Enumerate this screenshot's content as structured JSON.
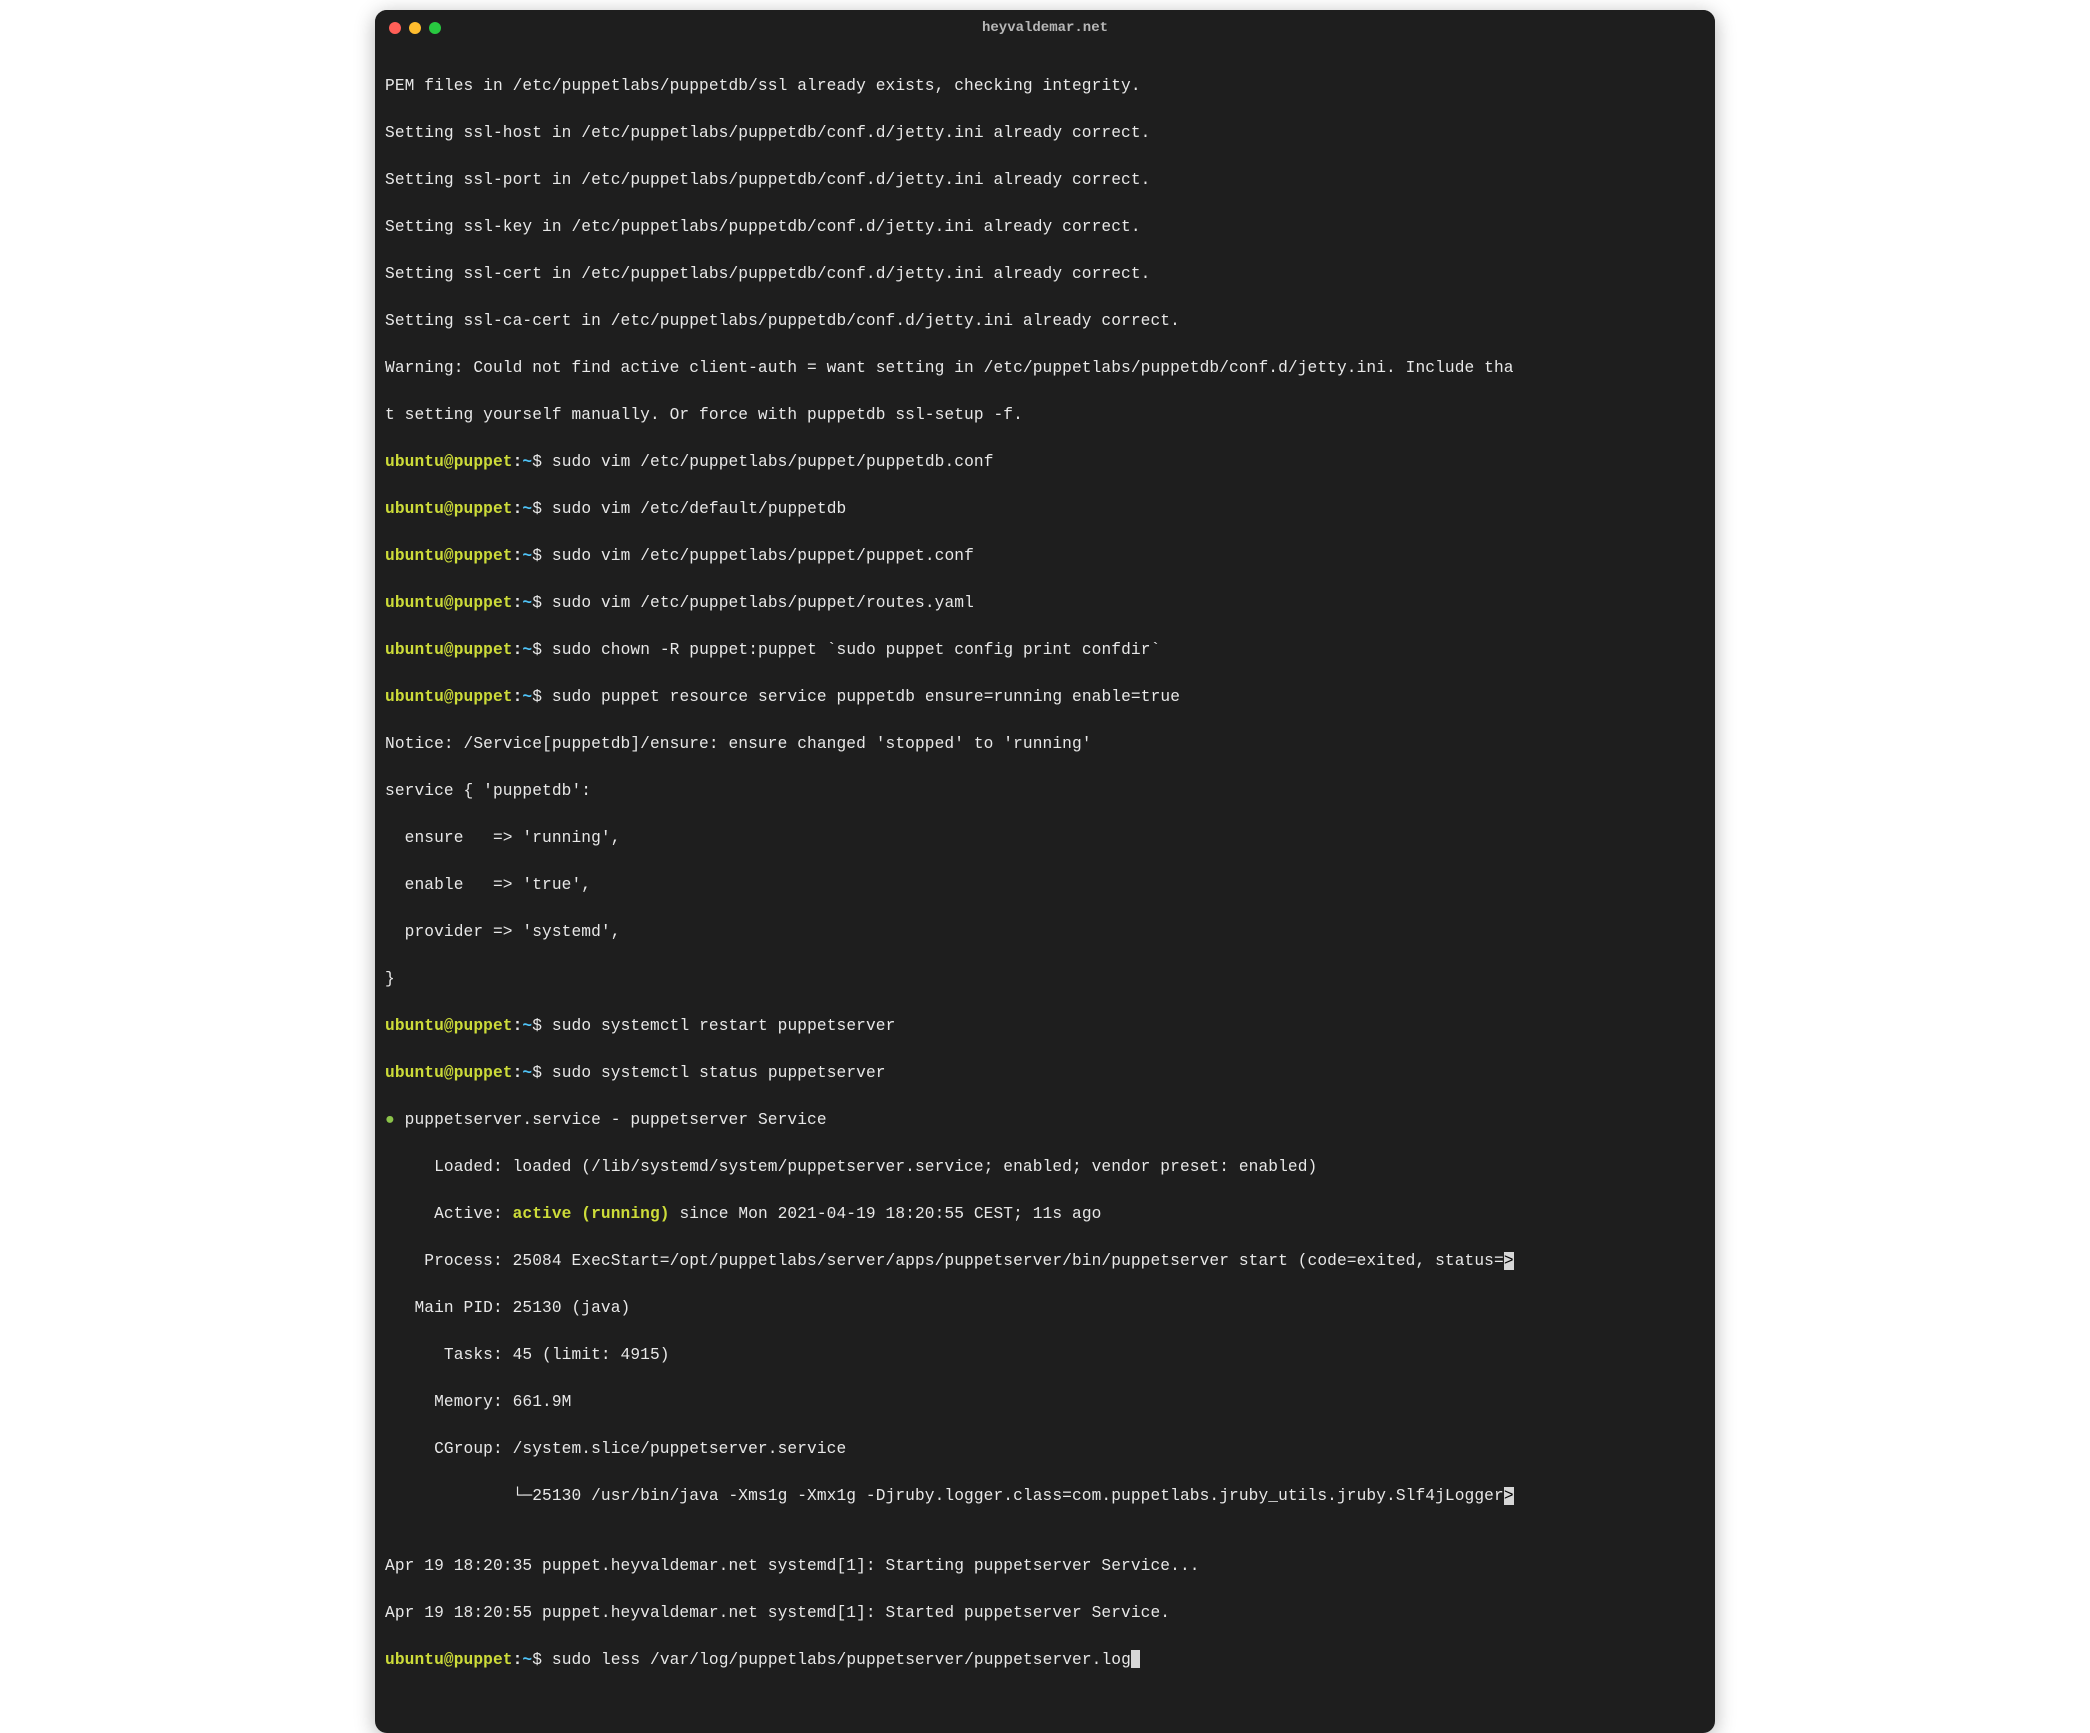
{
  "window": {
    "title": "heyvaldemar.net"
  },
  "prompt": {
    "user": "ubuntu@puppet",
    "sep": ":",
    "path": "~",
    "symbol": "$"
  },
  "lines": {
    "out0": "PEM files in /etc/puppetlabs/puppetdb/ssl already exists, checking integrity.",
    "out1": "Setting ssl-host in /etc/puppetlabs/puppetdb/conf.d/jetty.ini already correct.",
    "out2": "Setting ssl-port in /etc/puppetlabs/puppetdb/conf.d/jetty.ini already correct.",
    "out3": "Setting ssl-key in /etc/puppetlabs/puppetdb/conf.d/jetty.ini already correct.",
    "out4": "Setting ssl-cert in /etc/puppetlabs/puppetdb/conf.d/jetty.ini already correct.",
    "out5": "Setting ssl-ca-cert in /etc/puppetlabs/puppetdb/conf.d/jetty.ini already correct.",
    "out6": "Warning: Could not find active client-auth = want setting in /etc/puppetlabs/puppetdb/conf.d/jetty.ini. Include tha",
    "out7": "t setting yourself manually. Or force with puppetdb ssl-setup -f.",
    "cmd1": "sudo vim /etc/puppetlabs/puppet/puppetdb.conf",
    "cmd2": "sudo vim /etc/default/puppetdb",
    "cmd3": "sudo vim /etc/puppetlabs/puppet/puppet.conf",
    "cmd4": "sudo vim /etc/puppetlabs/puppet/routes.yaml",
    "cmd5": "sudo chown -R puppet:puppet `sudo puppet config print confdir`",
    "cmd6": "sudo puppet resource service puppetdb ensure=running enable=true",
    "out8": "Notice: /Service[puppetdb]/ensure: ensure changed 'stopped' to 'running'",
    "out9": "service { 'puppetdb':",
    "out10": "  ensure   => 'running',",
    "out11": "  enable   => 'true',",
    "out12": "  provider => 'systemd',",
    "out13": "}",
    "cmd7": "sudo systemctl restart puppetserver",
    "cmd8": "sudo systemctl status puppetserver",
    "svc_bullet": "●",
    "svc_name": " puppetserver.service - puppetserver Service",
    "svc_loaded": "     Loaded: loaded (/lib/systemd/system/puppetserver.service; enabled; vendor preset: enabled)",
    "svc_active_pre": "     Active: ",
    "svc_active_val": "active (running)",
    "svc_active_post": " since Mon 2021-04-19 18:20:55 CEST; 11s ago",
    "svc_process_pre": "    Process: 25084 ExecStart=/opt/puppetlabs/server/apps/puppetserver/bin/puppetserver start (code=exited, status=",
    "svc_process_tail": ">",
    "svc_mainpid": "   Main PID: 25130 (java)",
    "svc_tasks": "      Tasks: 45 (limit: 4915)",
    "svc_memory": "     Memory: 661.9M",
    "svc_cgroup": "     CGroup: /system.slice/puppetserver.service",
    "svc_cgroup2_pre": "             └─25130 /usr/bin/java -Xms1g -Xmx1g -Djruby.logger.class=com.puppetlabs.jruby_utils.jruby.Slf4jLogger",
    "svc_cgroup2_tail": ">",
    "blank": "",
    "log1": "Apr 19 18:20:35 puppet.heyvaldemar.net systemd[1]: Starting puppetserver Service...",
    "log2": "Apr 19 18:20:55 puppet.heyvaldemar.net systemd[1]: Started puppetserver Service.",
    "cmd9": "sudo less /var/log/puppetlabs/puppetserver/puppetserver.log"
  }
}
